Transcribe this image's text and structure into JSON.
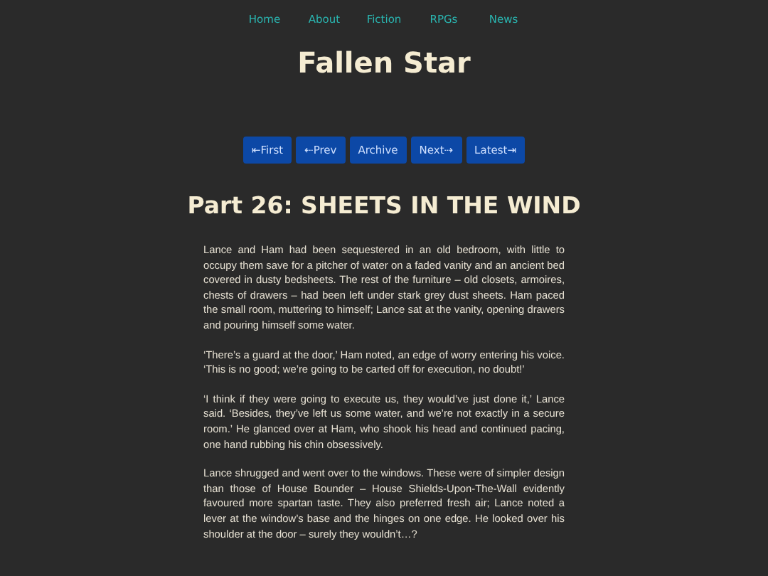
{
  "nav": [
    "Home",
    "About",
    "Fiction",
    "RPGs",
    "News"
  ],
  "site_title": "Fallen Star",
  "pager": [
    "⇤First",
    "⇠Prev",
    "Archive",
    "Next⇢",
    "Latest⇥"
  ],
  "chapter_title": "Part 26: SHEETS IN THE WIND",
  "paragraphs": [
    "Lance and Ham had been sequestered in an old bedroom, with little to occupy them save for a pitcher of water on a faded vanity and an ancient bed covered in dusty bedsheets. The rest of the furniture – old closets, armoires, chests of drawers – had been left under stark grey dust sheets. Ham paced the small room, muttering to himself; Lance sat at the vanity, opening drawers and pouring himself some water.",
    "‘There’s a guard at the door,’ Ham noted, an edge of worry entering his voice. ‘This is no good; we’re going to be carted off for execution, no doubt!’",
    "‘I think if they were going to execute us, they would’ve just done it,’ Lance said. ‘Besides, they’ve left us some water, and we’re not exactly in a secure room.’ He glanced over at Ham, who shook his head and continued pacing, one hand rubbing his chin obsessively.",
    "Lance shrugged and went over to the windows. These were of simpler design than those of House Bounder – House Shields-Upon-The-Wall evidently favoured more spartan taste. They also preferred fresh air; Lance noted a lever at the window’s base and the hinges on one edge. He looked over his shoulder at the door – surely they wouldn’t…?"
  ]
}
